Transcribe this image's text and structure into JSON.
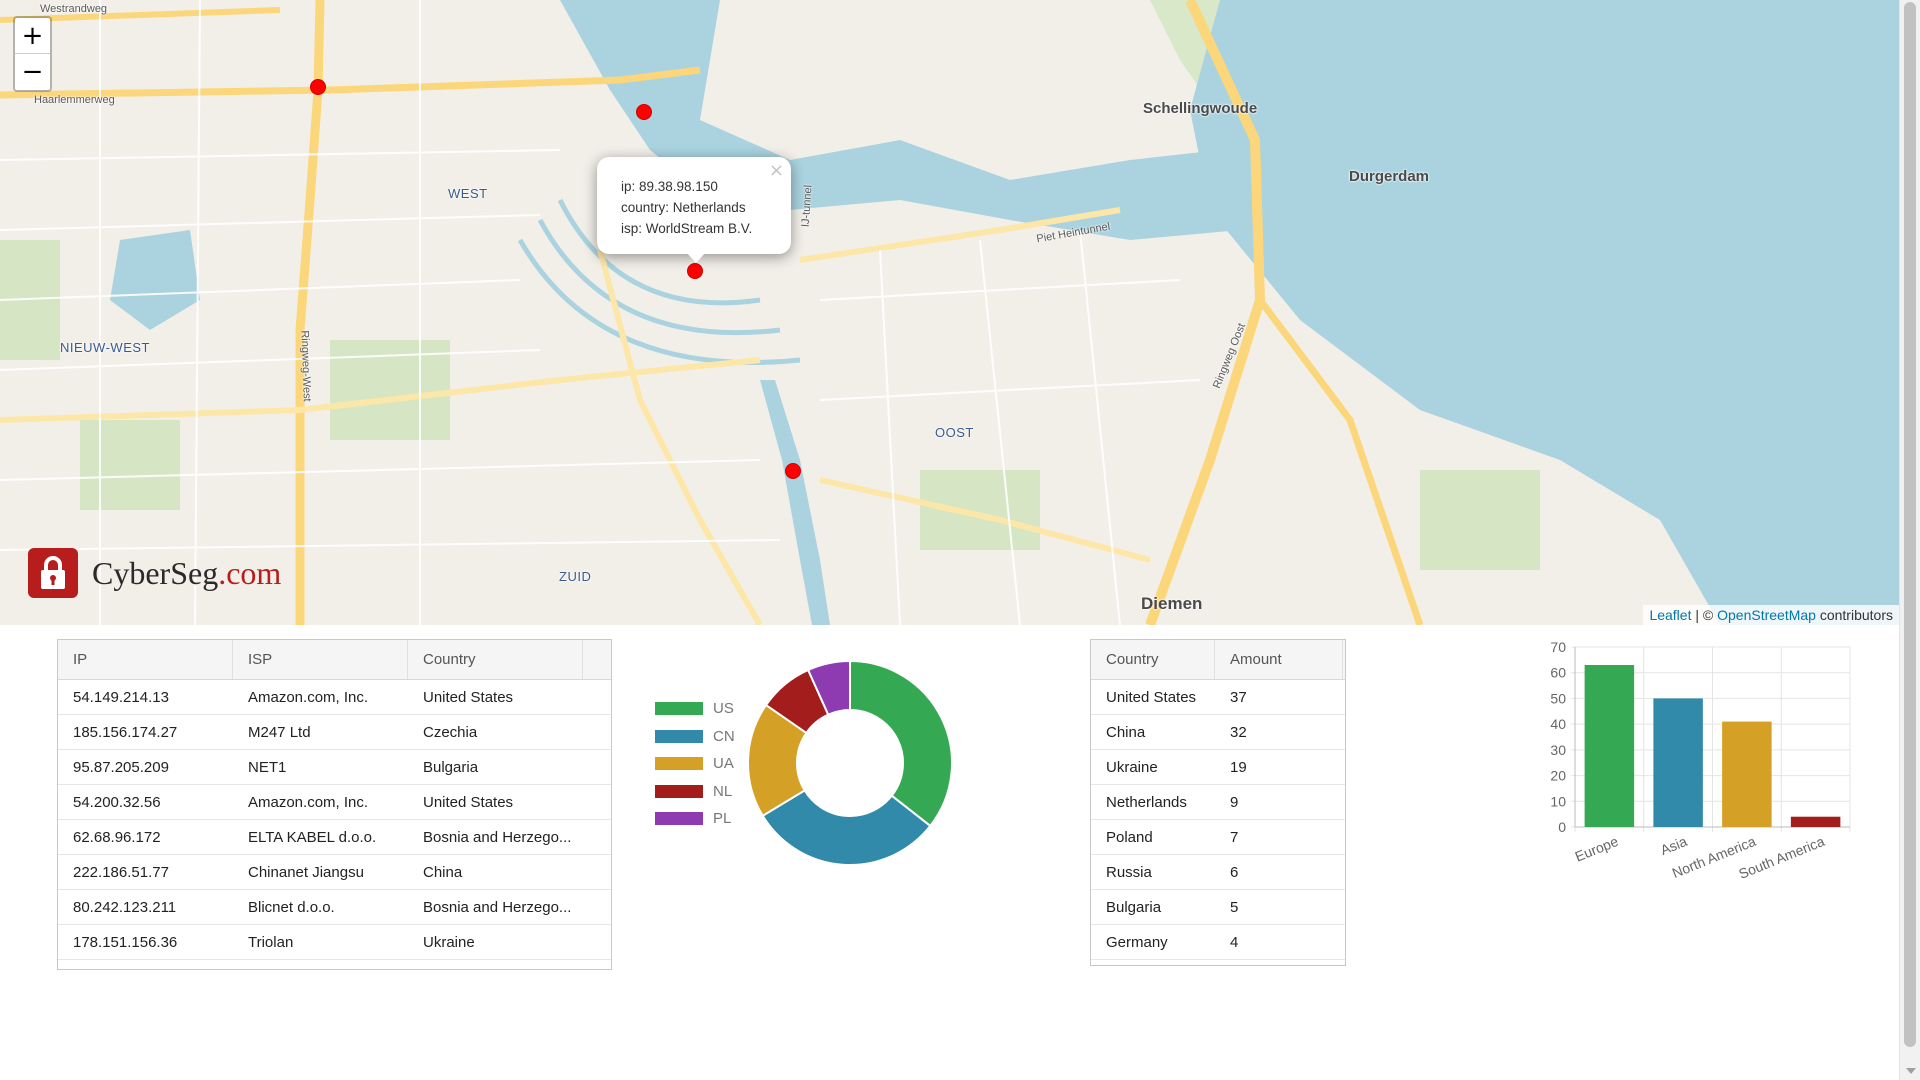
{
  "map": {
    "zoom_in": "+",
    "zoom_out": "−",
    "labels": {
      "haarlemmerweg": "Haarlemmerweg",
      "westrandweg": "Westrandweg",
      "west": "WEST",
      "nieuw_west": "NIEUW-WEST",
      "oost": "OOST",
      "zuid": "ZUID",
      "schellingwoude": "Schellingwoude",
      "durgerdam": "Durgerdam",
      "diemen": "Diemen",
      "piet_heintunnel": "Piet Heintunnel",
      "ij_tunnel": "IJ-tunnel",
      "ringweg_west": "Ringweg-West",
      "ringweg_oost": "Ringweg Oost"
    },
    "popup": {
      "ip": "ip: 89.38.98.150",
      "country": "country: Netherlands",
      "isp": "isp: WorldStream B.V.",
      "close": "×"
    },
    "attribution": {
      "leaflet": "Leaflet",
      "separator": " | © ",
      "osm": "OpenStreetMap",
      "suffix": " contributors"
    }
  },
  "logo": {
    "name": "CyberSeg",
    "domain": ".com"
  },
  "ip_table": {
    "headers": [
      "IP",
      "ISP",
      "Country"
    ],
    "rows": [
      [
        "54.149.214.13",
        "Amazon.com, Inc.",
        "United States"
      ],
      [
        "185.156.174.27",
        "M247 Ltd",
        "Czechia"
      ],
      [
        "95.87.205.209",
        "NET1",
        "Bulgaria"
      ],
      [
        "54.200.32.56",
        "Amazon.com, Inc.",
        "United States"
      ],
      [
        "62.68.96.172",
        "ELTA KABEL d.o.o.",
        "Bosnia and Herzego..."
      ],
      [
        "222.186.51.77",
        "Chinanet Jiangsu",
        "China"
      ],
      [
        "80.242.123.211",
        "Blicnet d.o.o.",
        "Bosnia and Herzego..."
      ],
      [
        "178.151.156.36",
        "Triolan",
        "Ukraine"
      ]
    ]
  },
  "country_table": {
    "headers": [
      "Country",
      "Amount"
    ],
    "rows": [
      [
        "United States",
        "37"
      ],
      [
        "China",
        "32"
      ],
      [
        "Ukraine",
        "19"
      ],
      [
        "Netherlands",
        "9"
      ],
      [
        "Poland",
        "7"
      ],
      [
        "Russia",
        "6"
      ],
      [
        "Bulgaria",
        "5"
      ],
      [
        "Germany",
        "4"
      ]
    ]
  },
  "colors": {
    "green": "#34a853",
    "blue": "#318aaa",
    "yellow": "#d4a025",
    "red": "#a31d1d",
    "purple": "#8e3ab0",
    "marker": "#ff0000"
  },
  "chart_data": [
    {
      "type": "pie",
      "variant": "donut",
      "categories": [
        "US",
        "CN",
        "UA",
        "NL",
        "PL"
      ],
      "values": [
        37,
        32,
        19,
        9,
        7
      ],
      "colors": [
        "#34a853",
        "#318aaa",
        "#d4a025",
        "#a31d1d",
        "#8e3ab0"
      ],
      "legend": "left"
    },
    {
      "type": "bar",
      "categories": [
        "Europe",
        "Asia",
        "North America",
        "South America"
      ],
      "values": [
        63,
        50,
        41,
        4
      ],
      "colors": [
        "#34a853",
        "#318aaa",
        "#d4a025",
        "#a31d1d"
      ],
      "ylim": [
        0,
        70
      ],
      "yticks": [
        "0",
        "10",
        "20",
        "30",
        "40",
        "50",
        "60",
        "70"
      ],
      "grid": true
    }
  ]
}
